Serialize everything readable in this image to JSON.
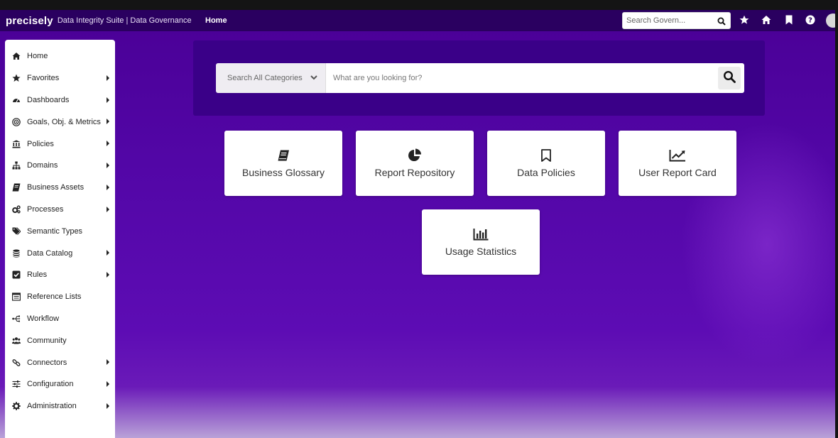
{
  "topbar": {
    "logo": "precisely",
    "suite": "Data Integrity Suite | Data Governance",
    "current_page": "Home",
    "search_placeholder": "Search Govern..."
  },
  "sidebar": {
    "items": [
      {
        "label": "Home",
        "icon": "home-icon",
        "has_submenu": false
      },
      {
        "label": "Favorites",
        "icon": "star-icon",
        "has_submenu": true
      },
      {
        "label": "Dashboards",
        "icon": "dashboard-icon",
        "has_submenu": true
      },
      {
        "label": "Goals, Obj. & Metrics",
        "icon": "target-icon",
        "has_submenu": true
      },
      {
        "label": "Policies",
        "icon": "building-columns-icon",
        "has_submenu": true
      },
      {
        "label": "Domains",
        "icon": "sitemap-icon",
        "has_submenu": true
      },
      {
        "label": "Business Assets",
        "icon": "book-icon",
        "has_submenu": true
      },
      {
        "label": "Processes",
        "icon": "cogs-icon",
        "has_submenu": true
      },
      {
        "label": "Semantic Types",
        "icon": "tags-icon",
        "has_submenu": false
      },
      {
        "label": "Data Catalog",
        "icon": "database-icon",
        "has_submenu": true
      },
      {
        "label": "Rules",
        "icon": "check-square-icon",
        "has_submenu": true
      },
      {
        "label": "Reference Lists",
        "icon": "list-table-icon",
        "has_submenu": false
      },
      {
        "label": "Workflow",
        "icon": "workflow-icon",
        "has_submenu": false
      },
      {
        "label": "Community",
        "icon": "users-icon",
        "has_submenu": false
      },
      {
        "label": "Connectors",
        "icon": "link-icon",
        "has_submenu": true
      },
      {
        "label": "Configuration",
        "icon": "sliders-icon",
        "has_submenu": true
      },
      {
        "label": "Administration",
        "icon": "gear-icon",
        "has_submenu": true
      }
    ]
  },
  "search": {
    "category": "Search All Categories",
    "placeholder": "What are you looking for?"
  },
  "cards": [
    {
      "label": "Business Glossary",
      "icon": "book-icon"
    },
    {
      "label": "Report Repository",
      "icon": "pie-chart-icon"
    },
    {
      "label": "Data Policies",
      "icon": "bookmark-icon"
    },
    {
      "label": "User Report Card",
      "icon": "line-chart-icon"
    },
    {
      "label": "Usage Statistics",
      "icon": "bar-chart-icon"
    }
  ],
  "colors": {
    "topbar": "#2a0060",
    "background": "#5206a6",
    "search_panel": "#3a0088",
    "card": "#ffffff"
  }
}
